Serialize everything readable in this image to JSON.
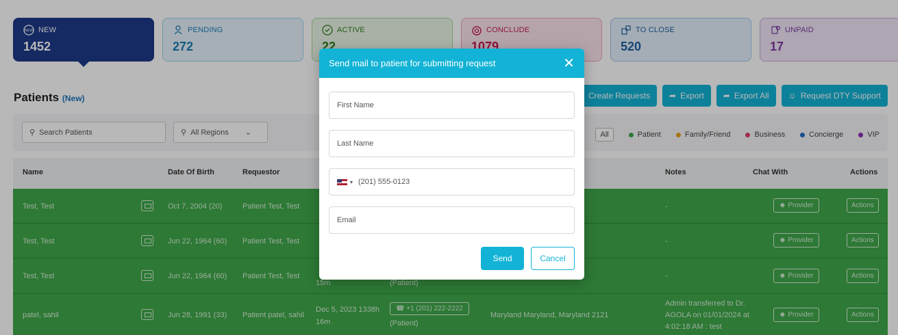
{
  "cards": [
    {
      "label": "NEW",
      "count": "1452",
      "icon": "new-icon"
    },
    {
      "label": "PENDING",
      "count": "272",
      "icon": "person-icon"
    },
    {
      "label": "ACTIVE",
      "count": "22",
      "icon": "check-circle-icon"
    },
    {
      "label": "CONCLUDE",
      "count": "1079",
      "icon": "alarm-icon"
    },
    {
      "label": "TO CLOSE",
      "count": "520",
      "icon": "close-doc-icon"
    },
    {
      "label": "UNPAID",
      "count": "17",
      "icon": "money-icon"
    }
  ],
  "page": {
    "title": "Patients",
    "subtitle": "(New)"
  },
  "toolbar": {
    "create_requests": "Create Requests",
    "export": "Export",
    "export_all": "Export All",
    "request_support": "Request DTY Support"
  },
  "filters": {
    "search_placeholder": "Search Patients",
    "region": "All Regions",
    "all": "All",
    "legend": [
      {
        "label": "Patient",
        "color": "#3fa84a"
      },
      {
        "label": "Family/Friend",
        "color": "#e8a21a"
      },
      {
        "label": "Business",
        "color": "#e0406a"
      },
      {
        "label": "Concierge",
        "color": "#1e6fbf"
      },
      {
        "label": "VIP",
        "color": "#8a2fb2"
      }
    ]
  },
  "table": {
    "headers": {
      "name": "Name",
      "dob": "Date Of Birth",
      "requestor": "Requestor",
      "notes": "Notes",
      "chat": "Chat With",
      "actions": "Actions"
    },
    "rows": [
      {
        "name": "Test, Test",
        "dob": "Oct 7, 2004 (20)",
        "requestor": "Patient Test, Test",
        "notes": "-",
        "chat": "Provider",
        "action": "Actions"
      },
      {
        "name": "Test, Test",
        "dob": "Jun 22, 1964 (60)",
        "requestor": "Patient Test, Test",
        "notes": "-",
        "chat": "Provider",
        "action": "Actions"
      },
      {
        "name": "Test, Test",
        "dob": "Jun 22, 1964 (60)",
        "requestor": "Patient Test, Test",
        "req_date": "15m",
        "phone_role": "(Patient)",
        "notes": "-",
        "chat": "Provider",
        "action": "Actions"
      },
      {
        "name": "patel, sahil",
        "dob": "Jun 28, 1991 (33)",
        "requestor": "Patient patel, sahil",
        "req_date": "Dec 5, 2023 1338h",
        "req_date2": "16m",
        "phone": "+1 (201) 222-2222",
        "phone_role": "(Patient)",
        "address": "Maryland Maryland, Maryland 2121",
        "notes": "Admin transferred to Dr. AGOLA on 01/01/2024 at 4:02:18 AM : test",
        "chat": "Provider",
        "action": "Actions"
      }
    ]
  },
  "modal": {
    "title": "Send mail to patient for submitting request",
    "first_name": "First Name",
    "last_name": "Last Name",
    "phone_placeholder": "(201) 555-0123",
    "email": "Email",
    "send": "Send",
    "cancel": "Cancel"
  }
}
